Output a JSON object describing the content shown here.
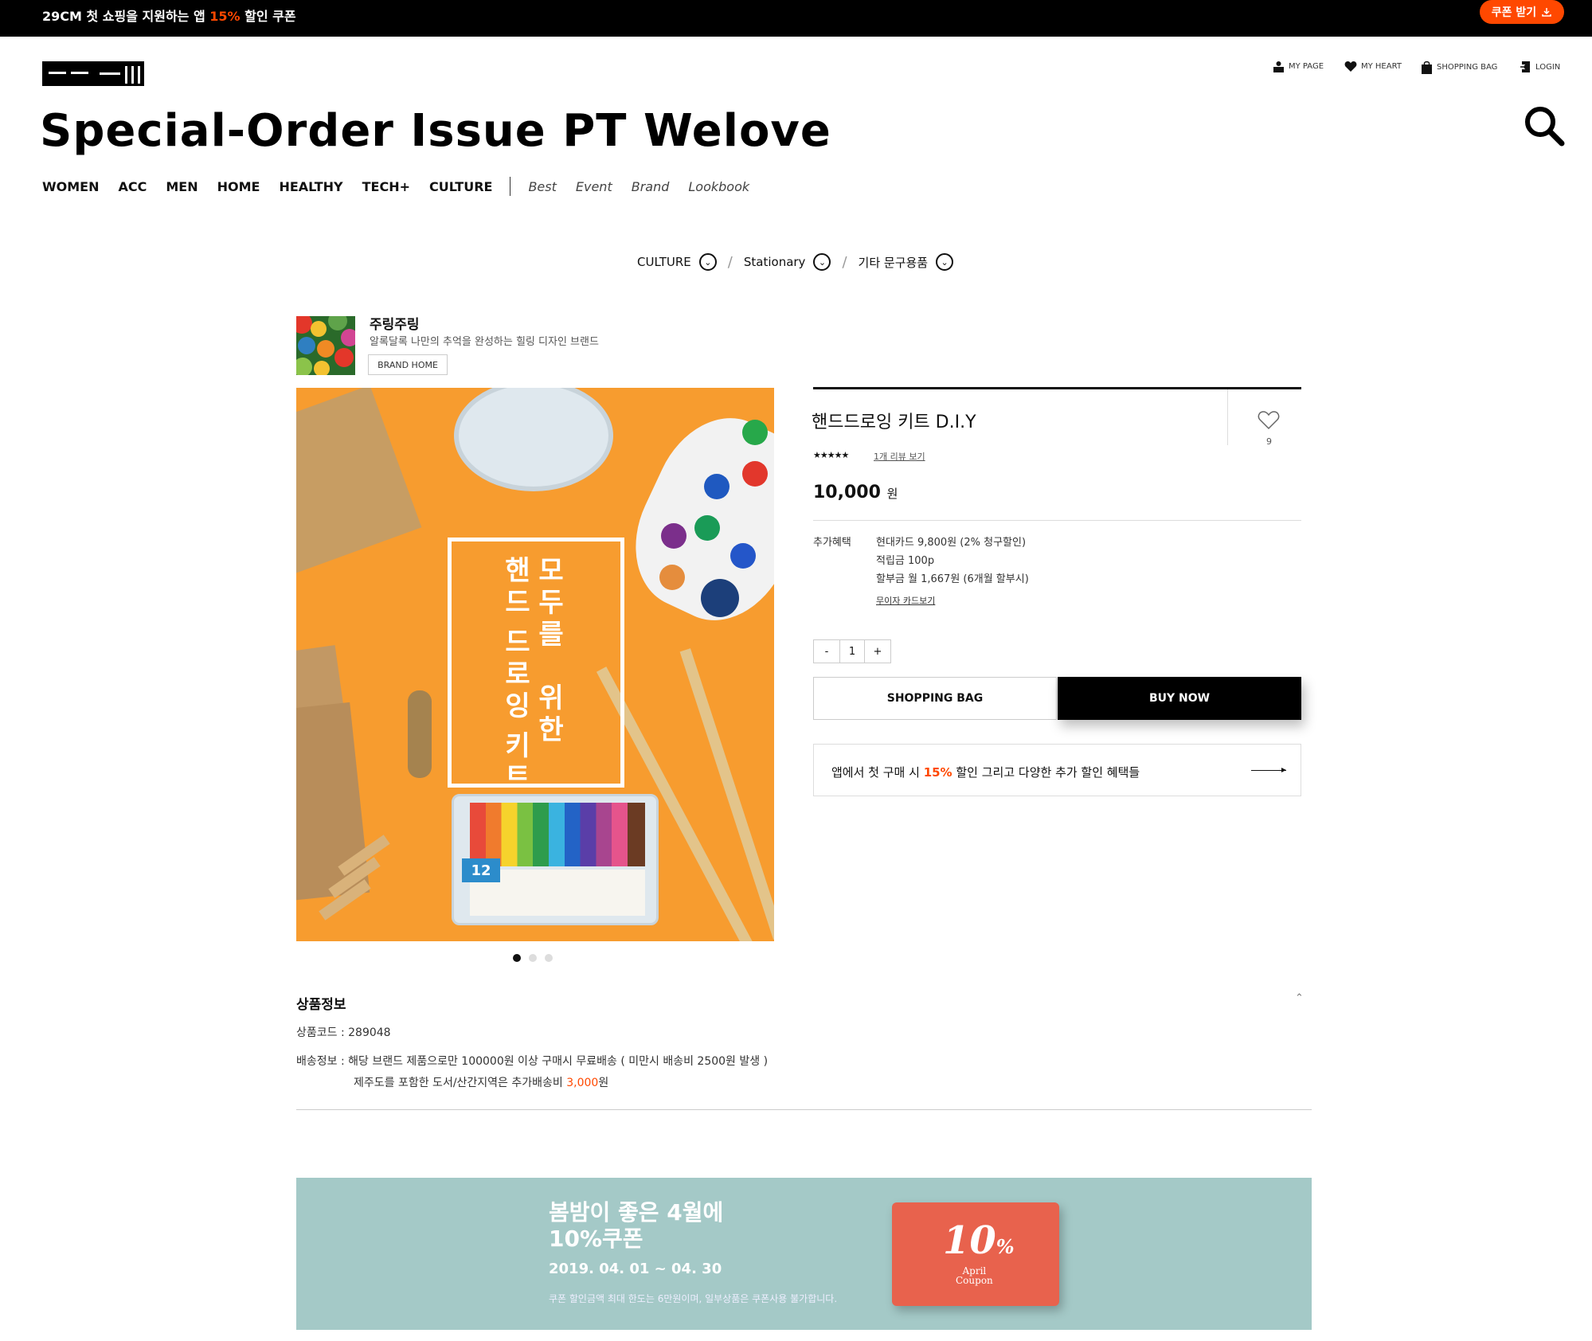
{
  "topbar": {
    "text_before": "29CM 첫 쇼핑을 지원하는 앱 ",
    "text_accent": "15%",
    "text_after": " 할인 쿠폰",
    "coupon_button": "쿠폰 받기"
  },
  "header": {
    "util_links": [
      "MY PAGE",
      "MY HEART",
      "SHOPPING BAG",
      "LOGIN"
    ],
    "big_title": "Special-Order  Issue  PT  Welove"
  },
  "nav": {
    "main": [
      "WOMEN",
      "ACC",
      "MEN",
      "HOME",
      "HEALTHY",
      "TECH+",
      "CULTURE"
    ],
    "sub": [
      "Best",
      "Event",
      "Brand",
      "Lookbook"
    ]
  },
  "breadcrumb": [
    "CULTURE",
    "Stationary",
    "기타 문구용품"
  ],
  "brand": {
    "name": "주링주링",
    "description": "알록달록 나만의 추억을 완성하는 힐링 디자인 브랜드",
    "home_button": "BRAND HOME"
  },
  "product_image": {
    "text_col_right": [
      "모",
      "두",
      "를",
      "",
      "위",
      "한"
    ],
    "text_col_left": [
      "핸",
      "드",
      "",
      "드",
      "로",
      "잉",
      "",
      "키",
      "트"
    ]
  },
  "product": {
    "name": "핸드드로잉 키트 D.I.Y",
    "heart_count": "9",
    "stars": "★★★★★",
    "rating": 5,
    "review_link": "1개 리뷰 보기",
    "price": "10,000",
    "price_unit": "원",
    "benefit_label": "추가혜택",
    "benefits": [
      "현대카드 9,800원 (2% 청구할인)",
      "적립금 100p",
      "할부금 월 1,667원 (6개월 할부시)"
    ],
    "card_link": "무이자 카드보기",
    "quantity": {
      "minus": "-",
      "value": "1",
      "plus": "+"
    },
    "shopping_bag_button": "SHOPPING BAG",
    "buy_now_button": "BUY NOW",
    "app_promo": {
      "before": "앱에서 첫 구매 시 ",
      "accent": "15%",
      "after": " 할인 그리고 다양한 추가 할인 혜택들"
    }
  },
  "details": {
    "title": "상품정보",
    "code_line": "상품코드 : 289048",
    "shipping_line": "배송정보 : 해당 브랜드 제품으로만 100000원 이상 구매시 무료배송 ( 미만시 배송비 2500원 발생 )",
    "jeju_before": "제주도를 포함한 도서/산간지역은 추가배송비 ",
    "jeju_accent": "3,000",
    "jeju_after": "원"
  },
  "banner": {
    "line1": "봄밤이 좋은 4월에",
    "line2": "10%쿠폰",
    "date": "2019. 04. 01 ~ 04. 30",
    "note": "쿠폰 할인금액 최대 한도는 6만원이며, 일부상품은 쿠폰사용 불가합니다.",
    "card_percent": "10",
    "card_percent_sign": "%",
    "card_line1": "April",
    "card_line2": "Coupon"
  },
  "colors": {
    "accent": "#ff4800",
    "banner_bg": "#a4c9c7",
    "coupon_card": "#e8624d",
    "product_bg": "#f79c2f"
  },
  "icons": [
    "download-icon",
    "user-icon",
    "heart-icon",
    "bag-icon",
    "login-icon",
    "search-icon",
    "chevron-down-icon",
    "heart-outline-icon",
    "arrow-right-icon",
    "caret-up-icon"
  ]
}
